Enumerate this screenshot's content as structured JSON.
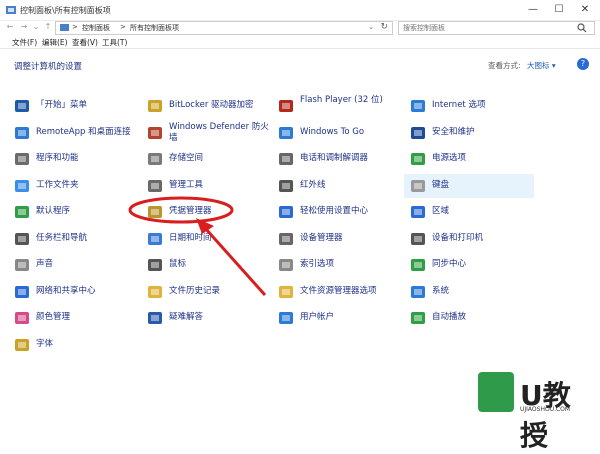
{
  "window": {
    "title": "控制面板\\所有控制面板项",
    "minimize": "—",
    "maximize": "☐",
    "close": "✕"
  },
  "address": {
    "crumbs": [
      "控制面板",
      "所有控制面板项"
    ],
    "separator": ">",
    "search_placeholder": "搜索控制面板"
  },
  "menu": [
    "文件(F)",
    "编辑(E)",
    "查看(V)",
    "工具(T)"
  ],
  "page": {
    "heading": "调整计算机的设置",
    "view_by_label": "查看方式:",
    "view_by_value": "大图标 ▾"
  },
  "items": [
    {
      "label": "「开始」菜单",
      "icon": "start-menu-icon",
      "color": "#1e5aa8"
    },
    {
      "label": "RemoteApp 和桌面连接",
      "icon": "remoteapp-icon",
      "color": "#2a7ad6"
    },
    {
      "label": "程序和功能",
      "icon": "programs-icon",
      "color": "#6b6b6b"
    },
    {
      "label": "工作文件夹",
      "icon": "work-folders-icon",
      "color": "#3a8ee6"
    },
    {
      "label": "默认程序",
      "icon": "default-programs-icon",
      "color": "#2f9e44"
    },
    {
      "label": "任务栏和导航",
      "icon": "taskbar-icon",
      "color": "#555555"
    },
    {
      "label": "声音",
      "icon": "speaker-icon",
      "color": "#888888"
    },
    {
      "label": "网络和共享中心",
      "icon": "network-icon",
      "color": "#2a6ad4"
    },
    {
      "label": "颜色管理",
      "icon": "color-management-icon",
      "color": "#d44a8a"
    },
    {
      "label": "字体",
      "icon": "font-icon",
      "color": "#c9a227"
    },
    {
      "label": "BitLocker 驱动器加密",
      "icon": "bitlocker-icon",
      "color": "#c9a227"
    },
    {
      "label": "Windows Defender 防火墙",
      "icon": "firewall-icon",
      "color": "#b5442c"
    },
    {
      "label": "存储空间",
      "icon": "storage-icon",
      "color": "#7a7a7a"
    },
    {
      "label": "管理工具",
      "icon": "admin-tools-icon",
      "color": "#6a6a6a"
    },
    {
      "label": "凭据管理器",
      "icon": "credential-icon",
      "color": "#b8952e"
    },
    {
      "label": "日期和时间",
      "icon": "clock-icon",
      "color": "#3a7bd5"
    },
    {
      "label": "鼠标",
      "icon": "mouse-icon",
      "color": "#555555"
    },
    {
      "label": "文件历史记录",
      "icon": "file-history-icon",
      "color": "#e0b43c"
    },
    {
      "label": "疑难解答",
      "icon": "troubleshoot-icon",
      "color": "#2a5aa8"
    },
    {
      "label": "Flash Player (32 位)",
      "icon": "flash-icon",
      "color": "#b02a1e"
    },
    {
      "label": "Windows To Go",
      "icon": "windows-to-go-icon",
      "color": "#2a7ad6"
    },
    {
      "label": "电话和调制解调器",
      "icon": "phone-icon",
      "color": "#666666"
    },
    {
      "label": "红外线",
      "icon": "infrared-icon",
      "color": "#555555"
    },
    {
      "label": "轻松使用设置中心",
      "icon": "ease-of-access-icon",
      "color": "#2a6ad4"
    },
    {
      "label": "设备管理器",
      "icon": "device-manager-icon",
      "color": "#666666"
    },
    {
      "label": "索引选项",
      "icon": "indexing-icon",
      "color": "#888888"
    },
    {
      "label": "文件资源管理器选项",
      "icon": "folder-options-icon",
      "color": "#e0b43c"
    },
    {
      "label": "用户帐户",
      "icon": "user-accounts-icon",
      "color": "#2a7ad6"
    },
    {
      "label": "Internet 选项",
      "icon": "internet-icon",
      "color": "#2a7ad6"
    },
    {
      "label": "安全和维护",
      "icon": "security-flag-icon",
      "color": "#1e4a9a"
    },
    {
      "label": "电源选项",
      "icon": "power-icon",
      "color": "#2f9e44"
    },
    {
      "label": "键盘",
      "icon": "keyboard-icon",
      "color": "#999999"
    },
    {
      "label": "区域",
      "icon": "region-icon",
      "color": "#2a6ad4"
    },
    {
      "label": "设备和打印机",
      "icon": "printer-icon",
      "color": "#555555"
    },
    {
      "label": "同步中心",
      "icon": "sync-icon",
      "color": "#2f9e44"
    },
    {
      "label": "系统",
      "icon": "system-icon",
      "color": "#2a7ad6"
    },
    {
      "label": "自动播放",
      "icon": "autoplay-icon",
      "color": "#2f9e44"
    }
  ],
  "annotation": {
    "color": "#d81e1e"
  },
  "watermark": {
    "text": "U教授",
    "subtext": "UJIAOSHOU.COM"
  }
}
